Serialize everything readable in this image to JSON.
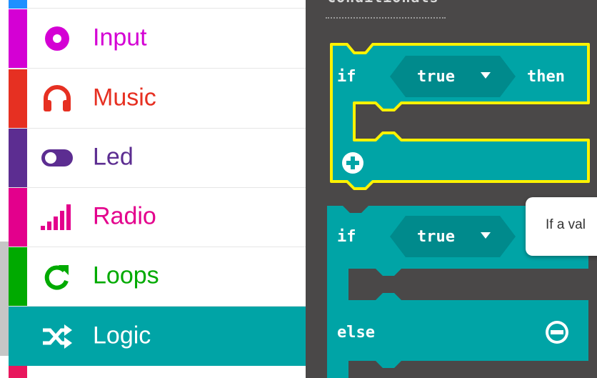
{
  "toolbox": {
    "categories": [
      {
        "label": "Input",
        "color": "#d400d4",
        "icon": "radio-button-icon",
        "selected": false
      },
      {
        "label": "Music",
        "color": "#e63022",
        "icon": "headphones-icon",
        "selected": false
      },
      {
        "label": "Led",
        "color": "#5c2d91",
        "icon": "toggle-icon",
        "selected": false
      },
      {
        "label": "Radio",
        "color": "#e3008c",
        "icon": "signal-bars-icon",
        "selected": false
      },
      {
        "label": "Loops",
        "color": "#00aa00",
        "icon": "loop-arrow-icon",
        "selected": false
      },
      {
        "label": "Logic",
        "color": "#00a4a6",
        "icon": "shuffle-icon",
        "selected": true
      }
    ]
  },
  "flyout": {
    "title": "Conditionals",
    "block_color": "#00a4a6",
    "block_dark": "#008a8c",
    "highlight": "#fff200",
    "if_block": {
      "if": "if",
      "value": "true",
      "then": "then"
    },
    "if_else_block": {
      "if": "if",
      "value": "true",
      "else": "else"
    }
  },
  "tooltip": {
    "text": "If a val"
  }
}
